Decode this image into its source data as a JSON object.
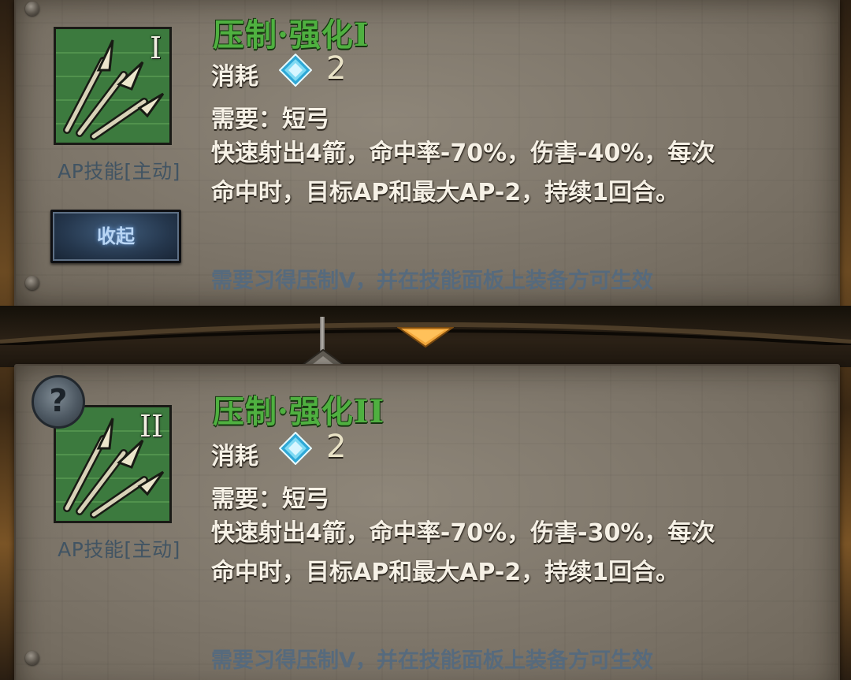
{
  "skills": [
    {
      "title": "压制·强化I",
      "rank": "I",
      "cost_label": "消耗",
      "cost_value": "2",
      "requirement": "需要：短弓",
      "description_line1": "快速射出4箭，命中率-70%，伤害-40%，每次",
      "description_line2": "命中时，目标AP和最大AP-2，持续1回合。",
      "type_label": "AP技能[主动]",
      "unlock_note": "需要习得压制V，并在技能面板上装备方可生效",
      "collapse_label": "收起"
    },
    {
      "title": "压制·强化II",
      "rank": "II",
      "cost_label": "消耗",
      "cost_value": "2",
      "requirement": "需要：短弓",
      "description_line1": "快速射出4箭，命中率-70%，伤害-30%，每次",
      "description_line2": "命中时，目标AP和最大AP-2，持续1回合。",
      "type_label": "AP技能[主动]",
      "unlock_note": "需要习得压制V，并在技能面板上装备方可生效",
      "help_label": "?"
    }
  ],
  "colors": {
    "title_green": "#4fb040",
    "note_blue": "#566a7d",
    "button_blue": "#25374d",
    "arrow_orange": "#f0a53a"
  },
  "icons": {
    "skill": "arrows-volley-icon",
    "cost": "crystal-gem-icon",
    "expand": "chevron-down-icon",
    "help": "question-icon"
  }
}
